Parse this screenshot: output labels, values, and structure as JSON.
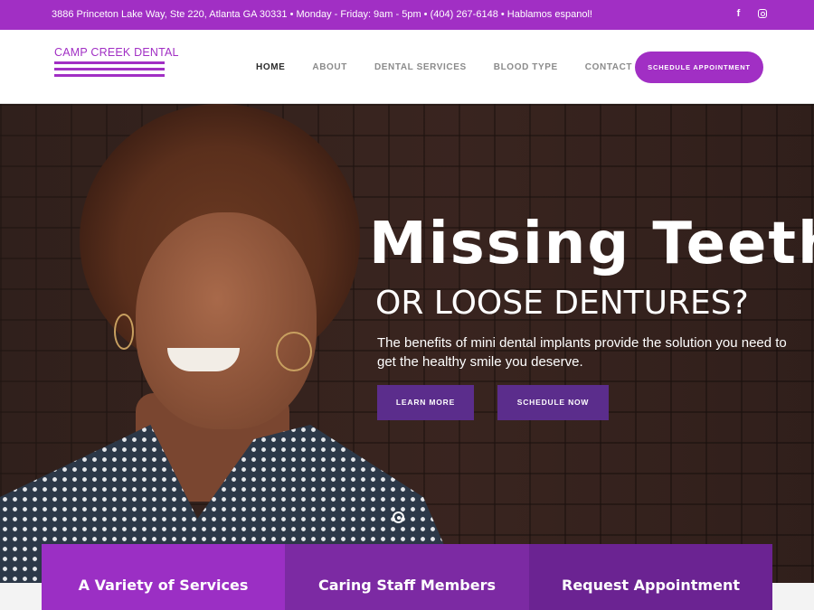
{
  "topbar": {
    "info": "3886 Princeton Lake Way, Ste 220, Atlanta GA 30331 • Monday - Friday: 9am - 5pm • (404) 267-6148 • Hablamos espanol!",
    "social": [
      "facebook-icon",
      "instagram-icon"
    ],
    "facebook_glyph": "f"
  },
  "header": {
    "logo_text": "CAMP CREEK DENTAL",
    "nav": [
      {
        "label": "HOME",
        "active": true
      },
      {
        "label": "ABOUT",
        "active": false
      },
      {
        "label": "DENTAL SERVICES",
        "active": false
      },
      {
        "label": "BLOOD TYPE",
        "active": false
      },
      {
        "label": "CONTACT",
        "active": false
      }
    ],
    "cta_label": "SCHEDULE APPOINTMENT"
  },
  "hero": {
    "headline": "Missing Teeth",
    "subheadline": "OR LOOSE DENTURES?",
    "body": "The benefits of mini dental implants provide the solution you need to get the healthy smile you deserve.",
    "learn_more_label": "LEARN MORE",
    "schedule_now_label": "SCHEDULE NOW"
  },
  "features": [
    {
      "label": "A Variety of Services"
    },
    {
      "label": "Caring Staff Members"
    },
    {
      "label": "Request Appointment"
    }
  ],
  "colors": {
    "brand": "#a12fc4",
    "button_dark": "#5b2d8c",
    "feature_1": "#9b2fc4",
    "feature_2": "#7c2aa3",
    "feature_3": "#6b2392"
  }
}
